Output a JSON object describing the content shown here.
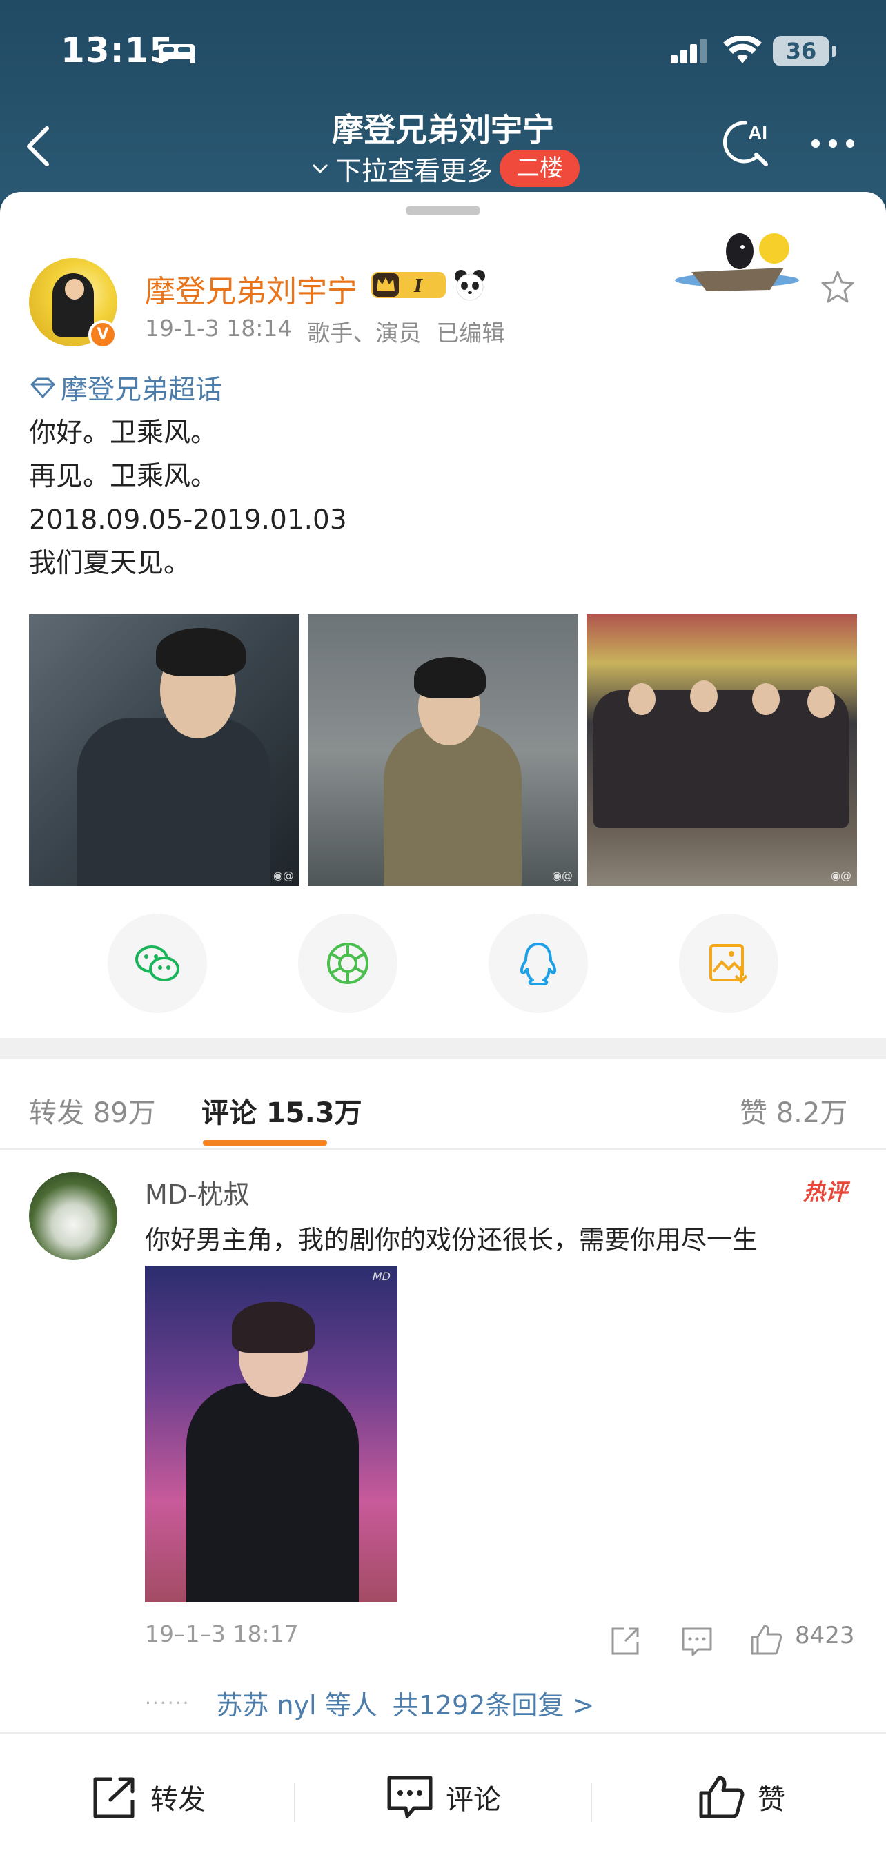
{
  "status_bar": {
    "time": "13:15",
    "battery": "36"
  },
  "nav": {
    "title": "摩登兄弟刘宇宁",
    "subtitle": "下拉查看更多",
    "badge": "二楼"
  },
  "post": {
    "author": "摩登兄弟刘宇宁",
    "badge_level": "I",
    "time": "19-1-3 18:14",
    "tags": "歌手、演员",
    "edited": "已编辑",
    "topic": "摩登兄弟超话",
    "lines": [
      "你好。卫乘风。",
      "再见。卫乘风。",
      "2018.09.05-2019.01.03",
      "我们夏天见。"
    ]
  },
  "share_icons": [
    "wechat-icon",
    "moments-icon",
    "qq-icon",
    "save-image-icon"
  ],
  "tabs": {
    "repost": "转发 89万",
    "comment": "评论 15.3万",
    "like": "赞 8.2万"
  },
  "comment": {
    "user": "MD-枕叔",
    "hot_label": "热评",
    "text": "你好男主角，我的剧你的戏份还很长，需要你用尽一生",
    "image_watermark": "MD",
    "time": "19–1–3 18:17",
    "likes": "8423",
    "reply_dots": "······",
    "reply_who": "苏苏 nyl 等人",
    "reply_count": "共1292条回复 >"
  },
  "bottom_bar": {
    "repost": "转发",
    "comment": "评论",
    "like": "赞"
  },
  "colors": {
    "header_bg": "#214a64",
    "accent_orange": "#f58220",
    "author_orange": "#e8741b",
    "badge_red": "#f04a3d",
    "link_blue": "#4d7dab"
  }
}
